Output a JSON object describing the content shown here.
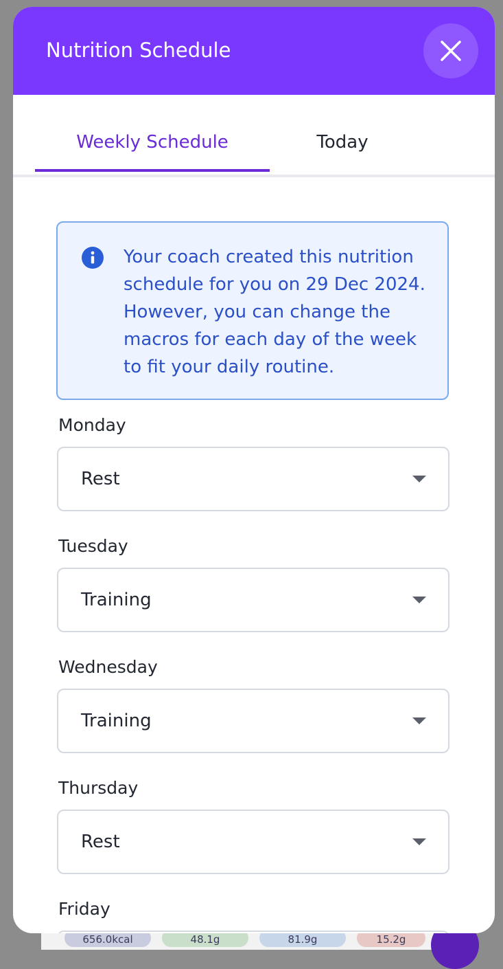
{
  "modal": {
    "title": "Nutrition Schedule",
    "close_icon": "close-icon"
  },
  "tabs": [
    {
      "label": "Weekly Schedule",
      "active": true
    },
    {
      "label": "Today",
      "active": false
    }
  ],
  "info": {
    "icon": "info-icon",
    "text": "Your coach created this nutrition schedule for you on 29 Dec 2024. However, you can change the macros for each day of the week to fit your daily routine."
  },
  "schedule": [
    {
      "day": "Monday",
      "value": "Rest"
    },
    {
      "day": "Tuesday",
      "value": "Training"
    },
    {
      "day": "Wednesday",
      "value": "Training"
    },
    {
      "day": "Thursday",
      "value": "Rest"
    },
    {
      "day": "Friday",
      "value": ""
    }
  ],
  "background_chips": [
    "656.0kcal",
    "48.1g",
    "81.9g",
    "15.2g"
  ],
  "colors": {
    "header": "#7a38ff",
    "accent": "#6a2bd6",
    "info_bg": "#eef4ff",
    "info_text": "#2a4fc7"
  }
}
